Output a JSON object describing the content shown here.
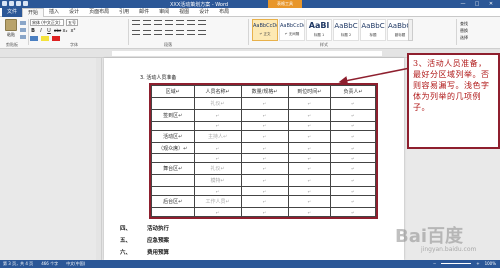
{
  "window": {
    "title": "XXX活动策划方案 - Word",
    "context_tab": "表格工具",
    "controls": [
      "—",
      "□",
      "✕"
    ]
  },
  "ribbon": {
    "tabs": [
      "文件",
      "开始",
      "插入",
      "设计",
      "页面布局",
      "引用",
      "邮件",
      "审阅",
      "视图",
      "设计",
      "布局"
    ],
    "active_tab": "开始",
    "paste_label": "粘贴",
    "font_name": "宋体 (中文正文)",
    "font_size": "五号",
    "format_buttons": [
      "B",
      "I",
      "U",
      "abc",
      "x₂",
      "x²"
    ],
    "group_labels": {
      "clipboard": "剪贴板",
      "font": "字体",
      "paragraph": "段落",
      "styles": "样式"
    },
    "styles": [
      {
        "preview": "AaBbCcDd",
        "name": "↵ 正文",
        "selected": true,
        "size": "small"
      },
      {
        "preview": "AaBbCcDd",
        "name": "↵ 无间隔",
        "selected": false,
        "size": "small"
      },
      {
        "preview": "AaBl",
        "name": "标题 1",
        "selected": false,
        "size": "big"
      },
      {
        "preview": "AaBbC",
        "name": "标题 2",
        "selected": false,
        "size": "mid"
      },
      {
        "preview": "AaBbC",
        "name": "标题",
        "selected": false,
        "size": "mid"
      },
      {
        "preview": "AaBbCc",
        "name": "副标题",
        "selected": false,
        "size": "mid"
      }
    ],
    "find_items": [
      "查找",
      "替换",
      "选择"
    ]
  },
  "document": {
    "heading": "3. 活动人员准备",
    "table": {
      "headers": [
        "区域↵",
        "人员名称↵",
        "数量/规格↵",
        "到位时间↵",
        "负责人↵"
      ],
      "rows": [
        [
          "",
          "礼仪↵",
          "↵",
          "↵",
          "↵"
        ],
        [
          "签到区↵",
          "↵",
          "↵",
          "↵",
          "↵"
        ],
        [
          "",
          "↵",
          "↵",
          "↵",
          "↵"
        ],
        [
          "活动区↵",
          "主持人↵",
          "↵",
          "↵",
          "↵"
        ],
        [
          "（观众席）↵",
          "↵",
          "↵",
          "↵",
          "↵"
        ],
        [
          "",
          "↵",
          "↵",
          "↵",
          "↵"
        ],
        [
          "舞台区↵",
          "礼仪↵",
          "↵",
          "↵",
          "↵"
        ],
        [
          "",
          "模特↵",
          "↵",
          "↵",
          "↵"
        ],
        [
          "",
          "↵",
          "↵",
          "↵",
          "↵"
        ],
        [
          "后台区↵",
          "工作人员↵",
          "↵",
          "↵",
          "↵"
        ],
        [
          "",
          "↵",
          "↵",
          "↵",
          "↵"
        ]
      ]
    },
    "list": [
      {
        "num": "四、",
        "text": "活动执行"
      },
      {
        "num": "五、",
        "text": "应急预案"
      },
      {
        "num": "六、",
        "text": "费用预算"
      }
    ]
  },
  "annotation": {
    "text": "3、活动人员准备，最好分区域列举。否则容易漏写。浅色字体为列举的几项例子。",
    "color": "#b01818",
    "border_color": "#8e1f2e"
  },
  "statusbar": {
    "page": "第 3 页，共 4 页",
    "words": "466 个字",
    "language": "中文(中国)",
    "zoom": "100%"
  },
  "watermark": {
    "text": "Bai百度",
    "sub": "jingyan.baidu.com"
  },
  "colors": {
    "titlebar": "#2b5797",
    "ribbon_bg": "#f7f7f7",
    "accent": "#e8962a"
  }
}
